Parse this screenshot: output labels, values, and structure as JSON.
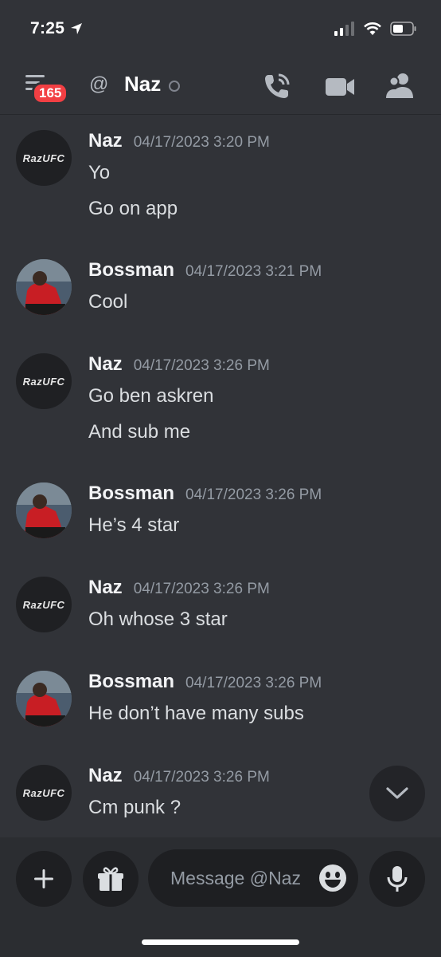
{
  "status": {
    "time": "7:25"
  },
  "header": {
    "unread_badge": "165",
    "at_symbol": "@",
    "channel_name": "Naz"
  },
  "avatars": {
    "naz_logo_text": "RazUFC"
  },
  "messages": [
    {
      "author": "Naz",
      "timestamp": "04/17/2023 3:20 PM",
      "lines": [
        "Yo",
        "Go on app"
      ]
    },
    {
      "author": "Bossman",
      "timestamp": "04/17/2023 3:21 PM",
      "lines": [
        "Cool"
      ]
    },
    {
      "author": "Naz",
      "timestamp": "04/17/2023 3:26 PM",
      "lines": [
        "Go ben askren",
        "And sub me"
      ]
    },
    {
      "author": "Bossman",
      "timestamp": "04/17/2023 3:26 PM",
      "lines": [
        "He’s 4 star"
      ]
    },
    {
      "author": "Naz",
      "timestamp": "04/17/2023 3:26 PM",
      "lines": [
        "Oh whose 3 star"
      ]
    },
    {
      "author": "Bossman",
      "timestamp": "04/17/2023 3:26 PM",
      "lines": [
        "He don’t have many subs"
      ]
    },
    {
      "author": "Naz",
      "timestamp": "04/17/2023 3:26 PM",
      "lines": [
        "Cm punk ?"
      ]
    }
  ],
  "composer": {
    "placeholder": "Message @Naz"
  },
  "colors": {
    "background": "#313338",
    "composer_bg": "#2b2d31",
    "badge": "#f23f43",
    "muted": "#949ba4"
  }
}
